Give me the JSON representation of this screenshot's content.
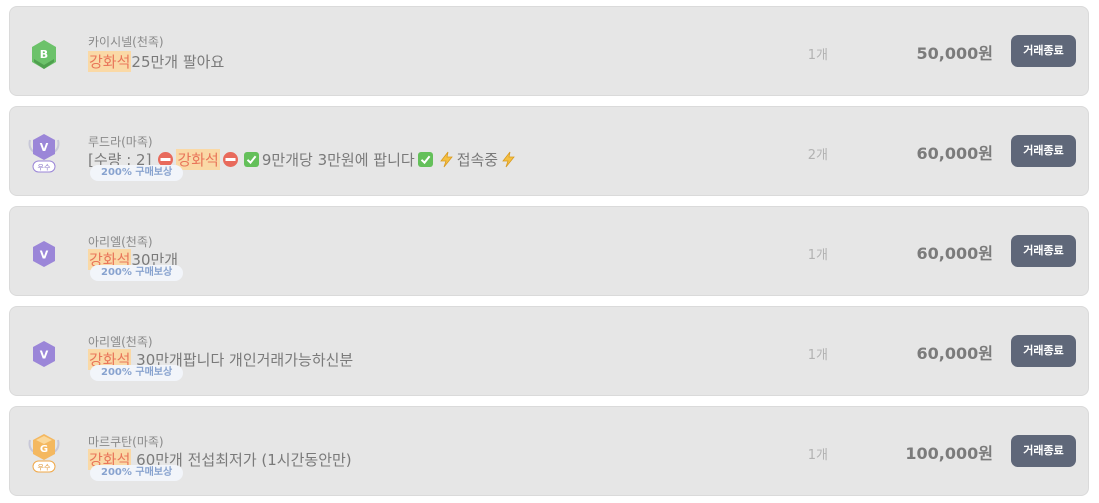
{
  "listings": [
    {
      "badge": "b-grade-icon",
      "seller": "카이시넬(천족)",
      "title_hl": "강화석",
      "title_rest": "25만개 팔아요",
      "quantity": "1개",
      "price": "50,000원",
      "button": "거래종료"
    },
    {
      "badge": "v-premium-icon",
      "badge_label": "우수",
      "seller": "루드라(마족)",
      "title_prefix": "[수량 : 2]",
      "title_hl": "강화석",
      "title_rest": "9만개당 3만원에 팝니다",
      "title_tail": "접속중",
      "reward": "200% 구매보상",
      "quantity": "2개",
      "price": "60,000원",
      "button": "거래종료"
    },
    {
      "badge": "v-grade-icon",
      "seller": "아리엘(천족)",
      "title_hl": "강화석",
      "title_rest": "30만개",
      "reward": "200% 구매보상",
      "quantity": "1개",
      "price": "60,000원",
      "button": "거래종료"
    },
    {
      "badge": "v-grade-icon",
      "seller": "아리엘(천족)",
      "title_hl": "강화석",
      "title_rest": " 30만개팝니다 개인거래가능하신분",
      "reward": "200% 구매보상",
      "quantity": "1개",
      "price": "60,000원",
      "button": "거래종료"
    },
    {
      "badge": "g-premium-icon",
      "badge_label": "우수",
      "seller": "마르쿠탄(마족)",
      "title_hl": "강화석",
      "title_rest": " 60만개 전섭최저가 (1시간동안만)",
      "reward": "200% 구매보상",
      "quantity": "1개",
      "price": "100,000원",
      "button": "거래종료"
    }
  ],
  "colors": {
    "row_bg": "#e6e6e6",
    "button_bg": "#5f6779",
    "highlight_bg": "#fad9a6",
    "highlight_text": "#e9765a",
    "reward_text": "#88a3cf"
  }
}
